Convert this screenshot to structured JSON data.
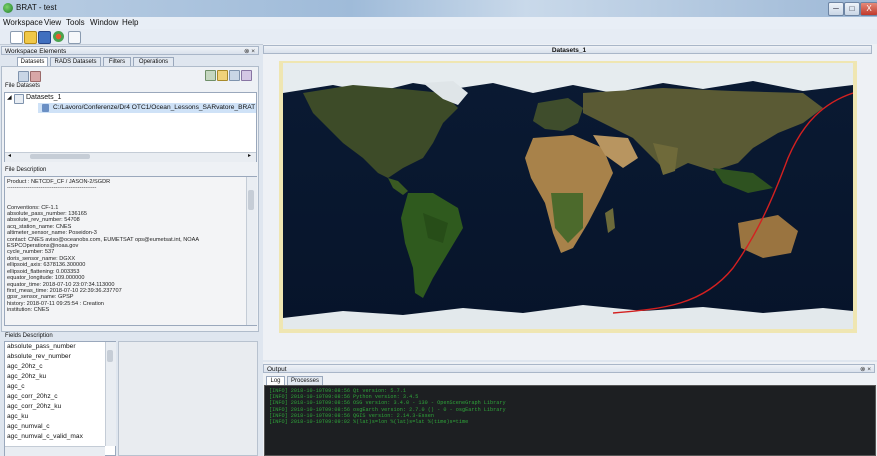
{
  "window": {
    "title": "BRAT - test",
    "minimize": "─",
    "maximize": "□",
    "close": "X"
  },
  "menu": [
    "Workspace",
    "View",
    "Tools",
    "Window",
    "Help"
  ],
  "toolbar_icons": [
    "new-file-icon",
    "open-folder-icon",
    "save-icon",
    "settings-icon",
    "export-icon"
  ],
  "workspace": {
    "title": "Workspace Elements",
    "pin": "⊗ ×",
    "tabs": [
      "Datasets",
      "RADS Datasets",
      "Filters",
      "Operations"
    ],
    "file_datasets_label": "File Datasets",
    "tree": {
      "root": "Datasets_1",
      "file": "C:/Lavoro/Conferenze/Dr4 OTC1/Ocean_Lessons_SARvatore_BRATL"
    },
    "file_description_label": "File Description",
    "description_lines": [
      "Product : NETCDF_CF / JASON-2/SGDR",
      "------------------------------------------------",
      "",
      "",
      "Conventions: CF-1.1",
      "absolute_pass_number: 136165",
      "absolute_rev_number: 54708",
      "acq_station_name: CNES",
      "altimeter_sensor_name: Poseidon-3",
      "contact: CNES aviso@oceanobs.com, EUMETSAT ops@eumetsat.int, NOAA",
      "ESPCOperations@noaa.gov",
      "cycle_number: 537",
      "doris_sensor_name: DGXX",
      "ellipsoid_axis: 6378136.300000",
      "ellipsoid_flattening: 0.003353",
      "equator_longitude: 109.000000",
      "equator_time: 2018-07-10 23:07:34.113000",
      "first_meas_time: 2018-07-10 22:39:36.237707",
      "gpsr_sensor_name: GPSP",
      "history: 2018-07-11 09:25:54 : Creation",
      "institution: CNES"
    ],
    "fields_label": "Fields Description",
    "fields": [
      "absolute_pass_number",
      "absolute_rev_number",
      "agc_20hz_c",
      "agc_20hz_ku",
      "agc_c",
      "agc_corr_20hz_c",
      "agc_corr_20hz_ku",
      "agc_ku",
      "agc_numval_c",
      "agc_numval_c_valid_max"
    ]
  },
  "map_view": {
    "title": "Datasets_1",
    "track_color": "#d42020"
  },
  "output": {
    "title": "Output",
    "tabs": [
      "Log",
      "Processes"
    ],
    "log_lines": [
      "[INFO] 2018-10-10T09:08:56  Qt version: 5.7.1",
      "[INFO] 2018-10-10T09:08:56  Python version: 3.4.5",
      "[INFO] 2018-10-10T09:08:56  OSG version: 3.4.0 - 130 - OpenSceneGraph Library",
      "[INFO] 2018-10-10T09:08:56  osgEarth version: 2.7.0 () - 0 - osgEarth Library",
      "[INFO] 2018-10-10T09:08:56  QGIS version: 2.14.3-Essen",
      "[INFO] 2018-10-10T09:09:02  %(lat)s=lon %(lat)s=lat %(time)s=time"
    ]
  }
}
